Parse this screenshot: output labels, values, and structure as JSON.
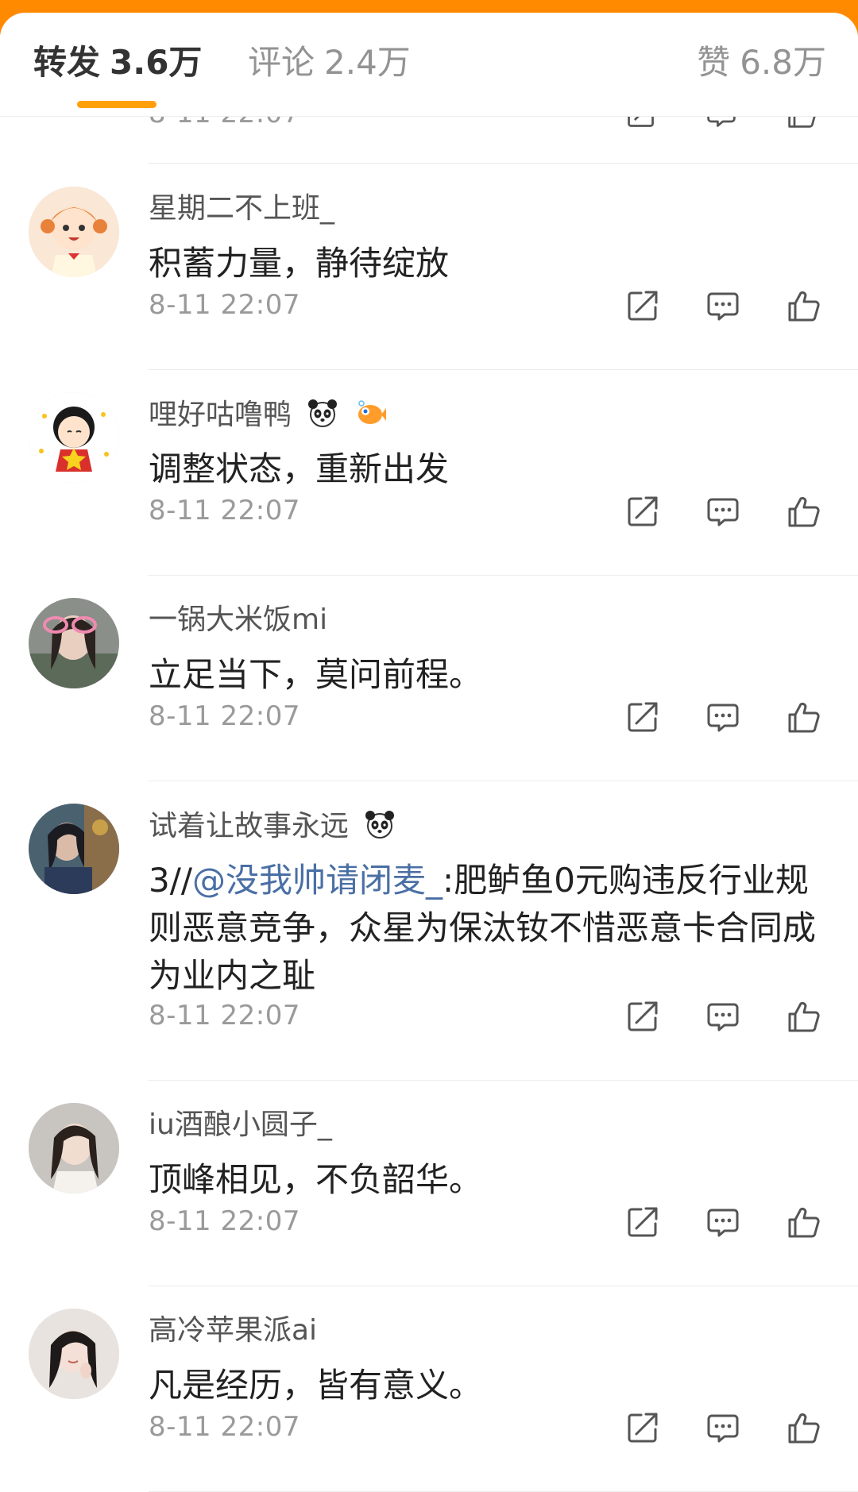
{
  "tabs": {
    "repost": {
      "label": "转发",
      "count": "3.6万"
    },
    "comment": {
      "label": "评论",
      "count": "2.4万"
    },
    "like": {
      "label": "赞",
      "count": "6.8万"
    }
  },
  "colors": {
    "accent": "#ff9f0a",
    "mention": "#4a6fa5",
    "text": "#222222",
    "muted": "#9a9a9a"
  },
  "comments": [
    {
      "user": "星期二不上班_",
      "text": "积蓄力量，静待绽放",
      "time": "8-11 22:07"
    },
    {
      "user": "哩好咕噜鸭",
      "text": "调整状态，重新出发",
      "time": "8-11 22:07"
    },
    {
      "user": "一锅大米饭mi",
      "text": "立足当下，莫问前程。",
      "time": "8-11 22:07"
    },
    {
      "user": "试着让故事永远",
      "text_prefix": "3//",
      "mention": "@没我帅请闭麦_",
      "text_rest": ":肥鲈鱼0元购违反行业规则恶意竞争，众星为保汰钕不惜恶意卡合同成为业内之耻",
      "time": "8-11 22:07"
    },
    {
      "user": "iu酒酿小圆子_",
      "text": "顶峰相见，不负韶华。",
      "time": "8-11 22:07"
    },
    {
      "user": "高冷苹果派ai",
      "text": "凡是经历，皆有意义。",
      "time": "8-11 22:07"
    }
  ],
  "icons": {
    "share": "share-icon",
    "reply": "comment-icon",
    "like": "thumbs-up-icon"
  }
}
